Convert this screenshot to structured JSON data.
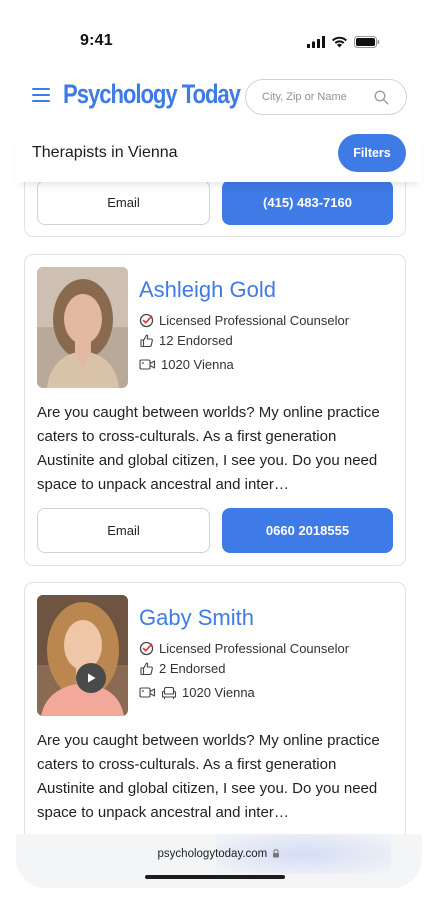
{
  "status_bar": {
    "time": "9:41"
  },
  "header": {
    "logo_text": "Psychology Today",
    "search_placeholder": "City, Zip or Name"
  },
  "subheader": {
    "title": "Therapists in Vienna",
    "filters_label": "Filters"
  },
  "cards": [
    {
      "email_label": "Email",
      "phone_label": "(415) 483-7160"
    },
    {
      "name": "Ashleigh Gold",
      "credential": "Licensed Professional Counselor",
      "endorsed": "12 Endorsed",
      "location": "1020 Vienna",
      "bio": "Are you caught between worlds? My online practice caters to cross-culturals. As a first generation Austinite and global citizen, I see you. Do you need space to unpack ancestral and inter…",
      "email_label": "Email",
      "phone_label": "0660 2018555"
    },
    {
      "name": "Gaby Smith",
      "credential": "Licensed Professional Counselor",
      "endorsed": "2 Endorsed",
      "location": "1020 Vienna",
      "bio": "Are you caught between worlds? My online practice caters to cross-culturals. As a first generation Austinite and global citizen, I see you. Do you need space to unpack ancestral and inter…"
    }
  ],
  "browser": {
    "url": "psychologytoday.com"
  },
  "colors": {
    "accent": "#3f7be6",
    "border": "#dfe2e6"
  }
}
